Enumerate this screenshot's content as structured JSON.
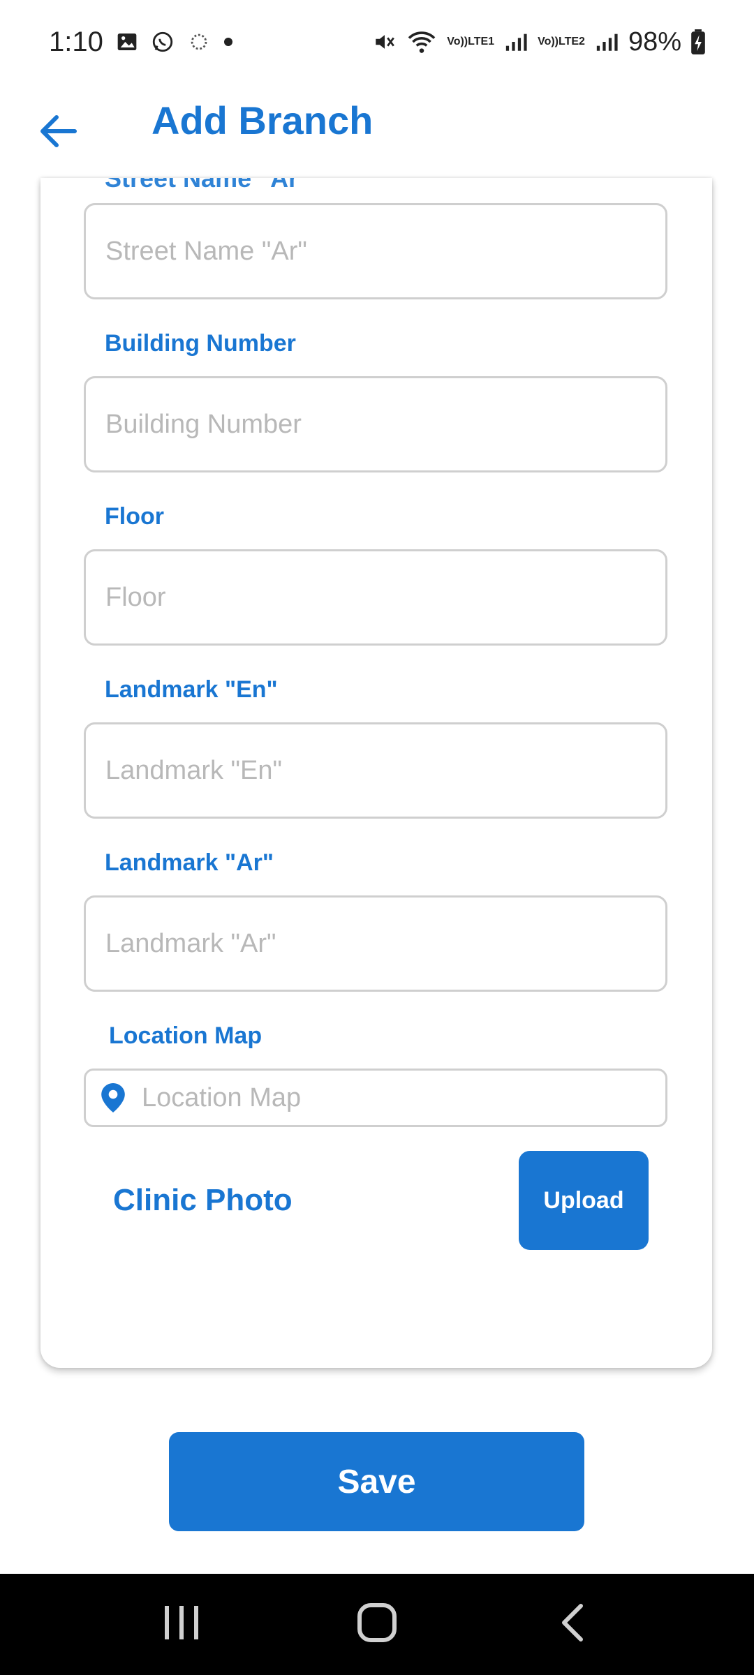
{
  "status_bar": {
    "time": "1:10",
    "battery": "98%",
    "lte1": "LTE1",
    "lte2": "LTE2",
    "volte": "Vo))"
  },
  "header": {
    "title": "Add Branch",
    "back_icon": "arrow-left-icon"
  },
  "form": {
    "cut_label": "Street Name \"Ar\"",
    "fields": [
      {
        "label": "",
        "placeholder": "Street Name \"Ar\"",
        "value": ""
      },
      {
        "label": "Building Number",
        "placeholder": "Building Number",
        "value": ""
      },
      {
        "label": "Floor",
        "placeholder": "Floor",
        "value": ""
      },
      {
        "label": "Landmark \"En\"",
        "placeholder": "Landmark \"En\"",
        "value": ""
      },
      {
        "label": "Landmark \"Ar\"",
        "placeholder": "Landmark \"Ar\"",
        "value": ""
      }
    ],
    "location": {
      "label": "Location Map",
      "placeholder": "Location Map",
      "icon": "location-pin-icon"
    },
    "clinic_photo": {
      "label": "Clinic Photo",
      "upload_label": "Upload"
    }
  },
  "save_label": "Save",
  "nav": {
    "recents": "recents-icon",
    "home": "home-icon",
    "back": "back-icon"
  },
  "colors": {
    "accent": "#1976d2",
    "placeholder": "#b8b8b8",
    "border": "#cfcfcf"
  }
}
